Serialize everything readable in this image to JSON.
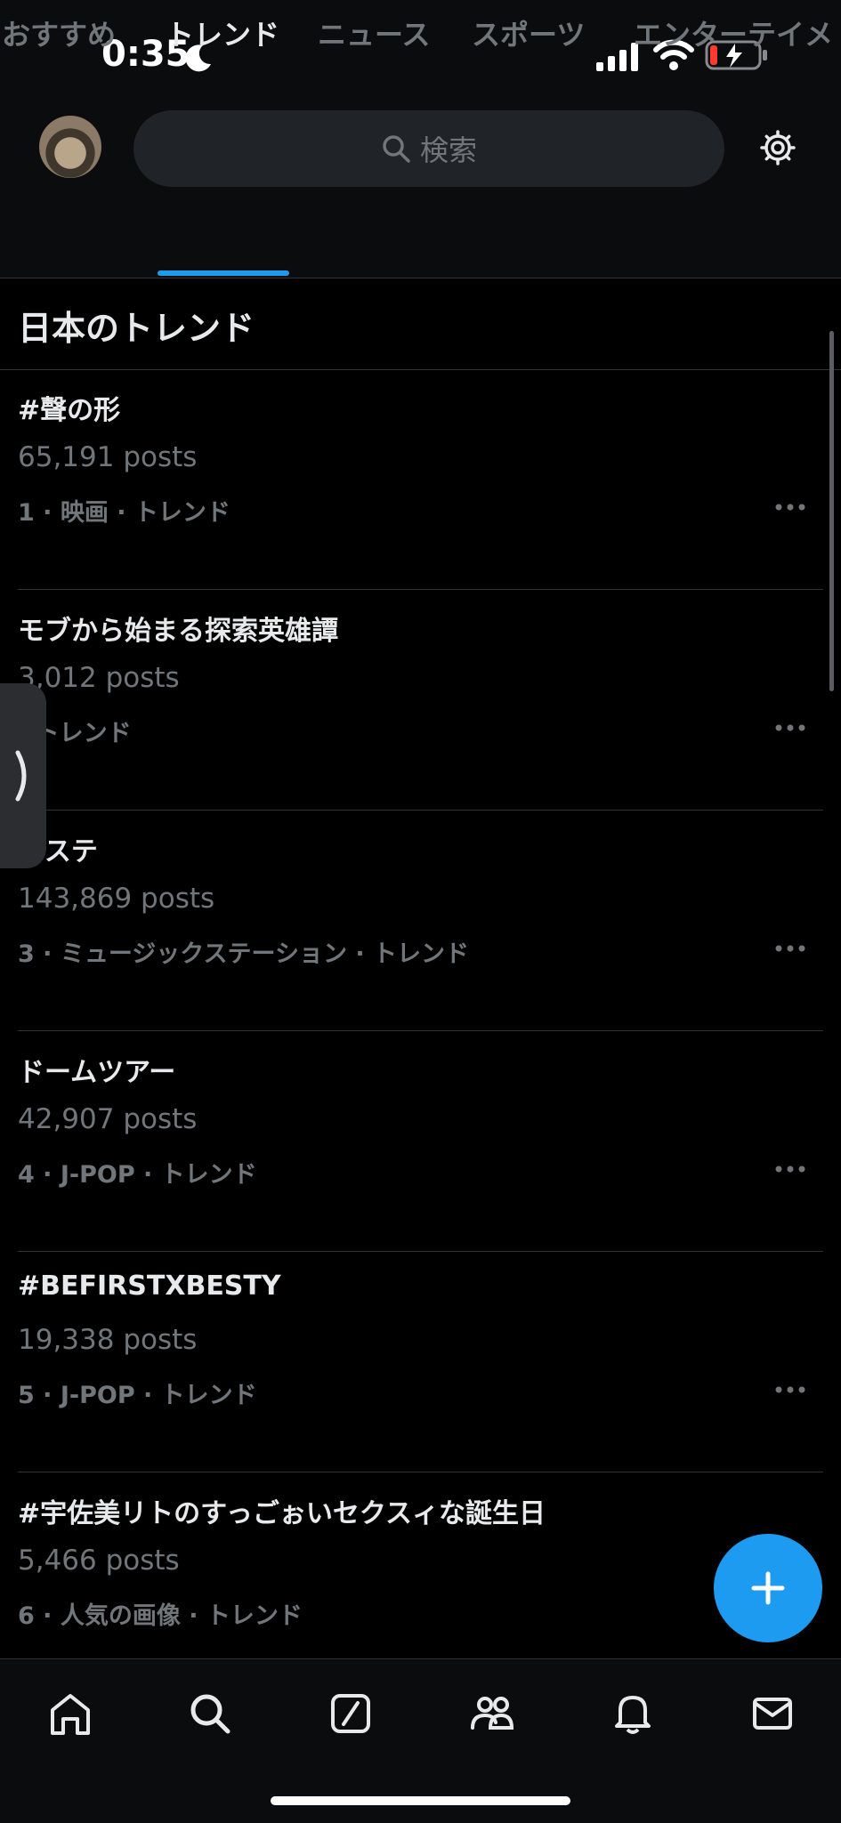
{
  "status_bar": {
    "time": "0:35"
  },
  "search": {
    "placeholder": "検索"
  },
  "tabs": [
    {
      "label": "おすすめ"
    },
    {
      "label": "トレンド"
    },
    {
      "label": "ニュース"
    },
    {
      "label": "スポーツ"
    },
    {
      "label": "エンターテイメ"
    }
  ],
  "section_title": "日本のトレンド",
  "trends": [
    {
      "name": "#聲の形",
      "posts": "65,191 posts",
      "meta": "1 · 映画 · トレンド"
    },
    {
      "name": "モブから始まる探索英雄譚",
      "posts": "3,012 posts",
      "meta": "· トレンド"
    },
    {
      "name": "Mステ",
      "posts": "143,869 posts",
      "meta": "3 · ミュージックステーション · トレンド"
    },
    {
      "name": "ドームツアー",
      "posts": "42,907 posts",
      "meta": "4 · J-POP · トレンド"
    },
    {
      "name": "#BEFIRSTXBESTY",
      "posts": "19,338 posts",
      "meta": "5 · J-POP · トレンド"
    },
    {
      "name": "#宇佐美リトのすっごぉいセクスィな誕生日",
      "posts": "5,466 posts",
      "meta": "6 · 人気の画像 · トレンド"
    }
  ],
  "icons": {
    "search": "search-icon",
    "settings": "gear-icon",
    "more": "more-icon",
    "compose": "plus-icon",
    "nav": [
      "home-icon",
      "search-icon",
      "grok-icon",
      "communities-icon",
      "bell-icon",
      "mail-icon"
    ]
  },
  "colors": {
    "accent": "#1d9bf0",
    "background": "#000000",
    "battery_low": "#ff3b30"
  }
}
